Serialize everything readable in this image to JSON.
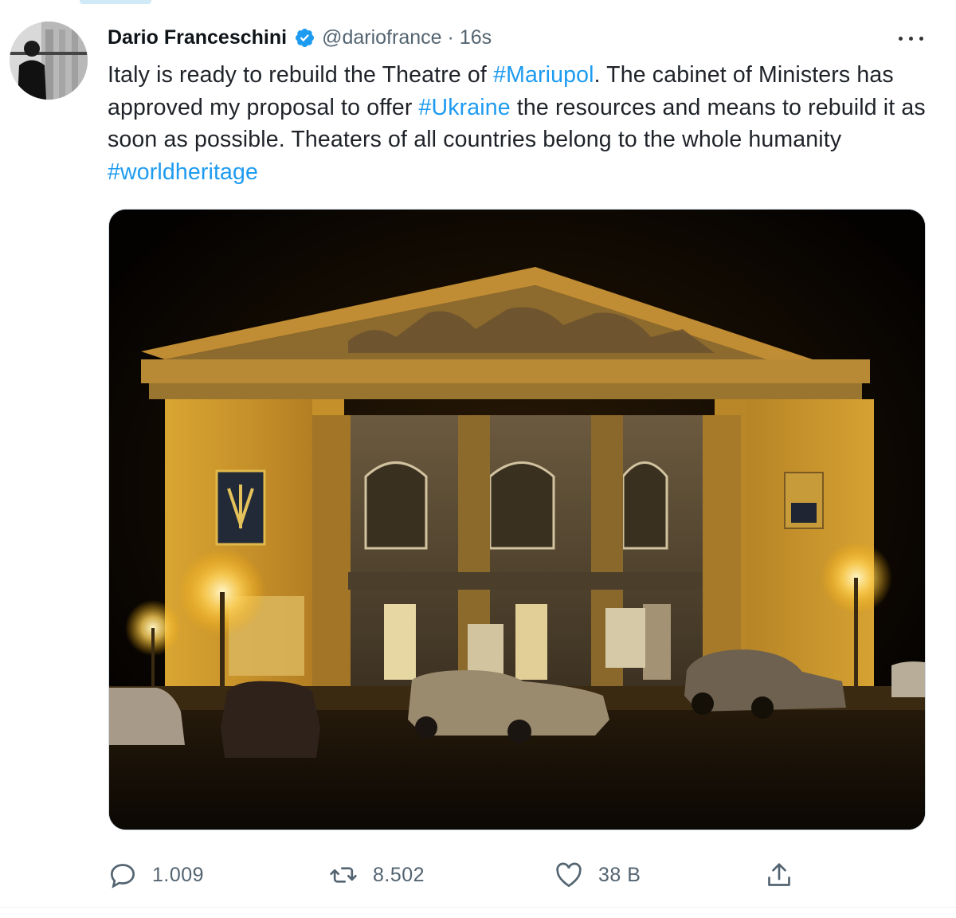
{
  "tweet": {
    "author": {
      "name": "Dario Franceschini",
      "handle": "@dariofrance",
      "separator": "·",
      "time": "16s",
      "verified": true
    },
    "text": {
      "part1": "Italy is ready to rebuild the Theatre of ",
      "hashtag1": "#Mariupol",
      "part2": ". The cabinet of Ministers has approved my proposal to offer ",
      "hashtag2": "#Ukraine",
      "part3": " the resources and means to rebuild it as soon as possible. Theaters of all countries belong to the whole humanity ",
      "hashtag3": "#worldheritage"
    },
    "media": {
      "subject": "Mariupol Drama Theatre at night"
    },
    "actions": {
      "reply_count": "1.009",
      "retweet_count": "8.502",
      "like_count": "38 B"
    }
  },
  "colors": {
    "hashtag": "#1d9bf0",
    "verified_badge": "#1d9bf0",
    "text": "#0f1419",
    "secondary_text": "#536471"
  },
  "icons": {
    "reply": "speech-bubble-icon",
    "retweet": "retweet-icon",
    "like": "heart-icon",
    "share": "share-upload-icon",
    "more": "ellipsis-icon",
    "verified": "verified-badge-icon"
  }
}
